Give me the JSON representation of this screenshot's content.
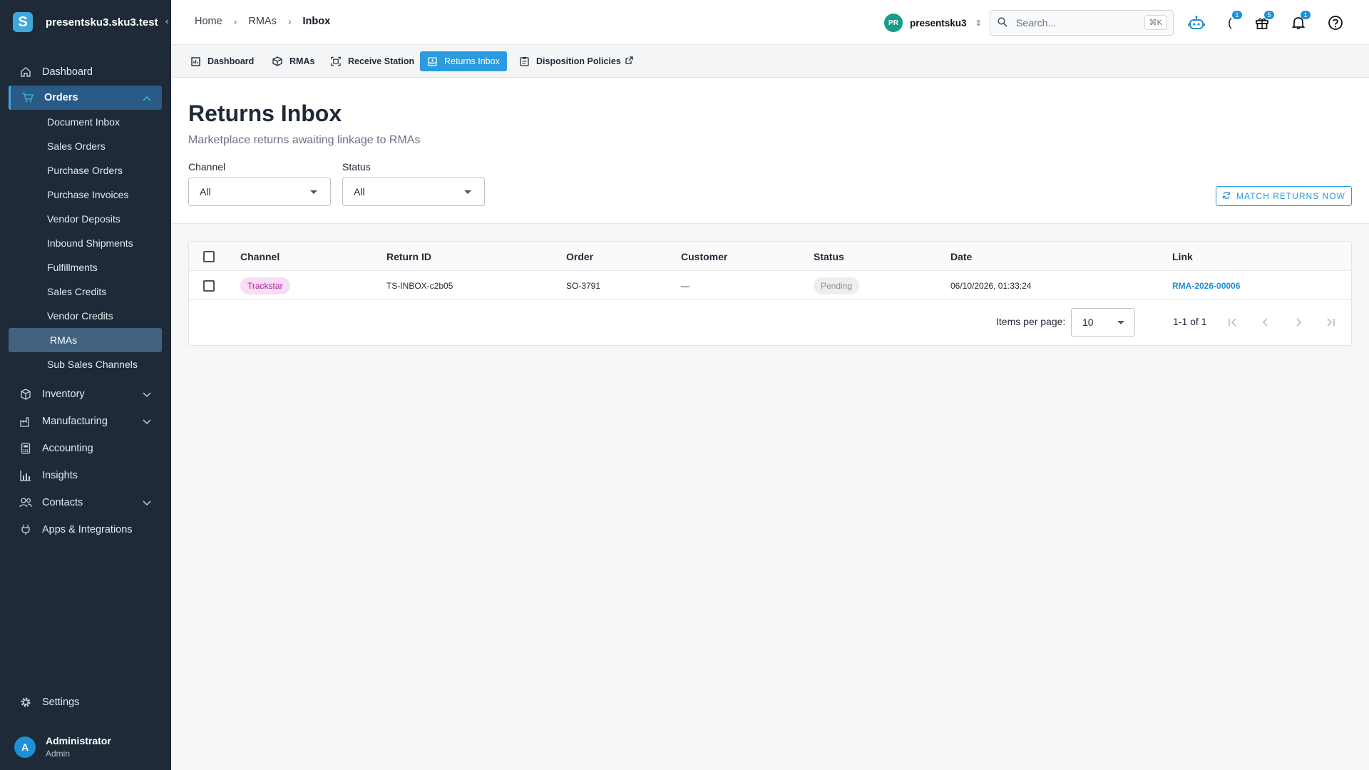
{
  "app": {
    "org_domain": "presentsku3.sku3.test",
    "logo_letter": "S"
  },
  "sidebar": {
    "items": [
      {
        "label": "Dashboard",
        "icon": "home-icon"
      },
      {
        "label": "Orders",
        "icon": "cart-icon",
        "expanded": true
      },
      {
        "label": "Inventory",
        "icon": "box-icon"
      },
      {
        "label": "Manufacturing",
        "icon": "factory-icon"
      },
      {
        "label": "Accounting",
        "icon": "calculator-icon"
      },
      {
        "label": "Insights",
        "icon": "bar-chart-icon"
      },
      {
        "label": "Contacts",
        "icon": "people-icon"
      },
      {
        "label": "Apps & Integrations",
        "icon": "plug-icon"
      }
    ],
    "orders_sub": [
      "Document Inbox",
      "Sales Orders",
      "Purchase Orders",
      "Purchase Invoices",
      "Vendor Deposits",
      "Inbound Shipments",
      "Fulfillments",
      "Sales Credits",
      "Vendor Credits",
      "RMAs",
      "Sub Sales Channels"
    ],
    "active_sub": "RMAs",
    "settings_label": "Settings",
    "user": {
      "initial": "A",
      "name": "Administrator",
      "role": "Admin"
    }
  },
  "header": {
    "breadcrumb": [
      "Home",
      "RMAs",
      "Inbox"
    ],
    "org": {
      "initials": "PR",
      "name": "presentsku3"
    },
    "search": {
      "placeholder": "Search...",
      "shortcut": "⌘K"
    },
    "badges": {
      "notes": "1",
      "gifts": "5",
      "notifications": "1"
    }
  },
  "tabs": [
    {
      "label": "Dashboard",
      "icon": "dashboard-icon"
    },
    {
      "label": "RMAs",
      "icon": "package-icon"
    },
    {
      "label": "Receive Station",
      "icon": "scan-icon"
    },
    {
      "label": "Returns Inbox",
      "icon": "inbox-icon",
      "active": true
    },
    {
      "label": "Disposition Policies",
      "icon": "clipboard-icon",
      "external": true
    }
  ],
  "page": {
    "title": "Returns Inbox",
    "subtitle": "Marketplace returns awaiting linkage to RMAs",
    "filters": {
      "channel": {
        "label": "Channel",
        "value": "All"
      },
      "status": {
        "label": "Status",
        "value": "All"
      }
    },
    "match_button": "MATCH RETURNS NOW"
  },
  "table": {
    "columns": [
      "Channel",
      "Return ID",
      "Order",
      "Customer",
      "Status",
      "Date",
      "Link"
    ],
    "rows": [
      {
        "channel": "Trackstar",
        "return_id": "TS-INBOX-c2b05",
        "order": "SO-3791",
        "customer": "—",
        "status": "Pending",
        "date": "06/10/2026, 01:33:24",
        "link": "RMA-2026-00006"
      }
    ],
    "pagination": {
      "items_per_page_label": "Items per page:",
      "items_per_page": "10",
      "range": "1-1 of 1"
    }
  },
  "colors": {
    "sidebar_bg": "#1e2a38",
    "accent": "#2a9be0",
    "channel_chip": "#f9dcf5",
    "status_chip": "#eeeeee"
  }
}
